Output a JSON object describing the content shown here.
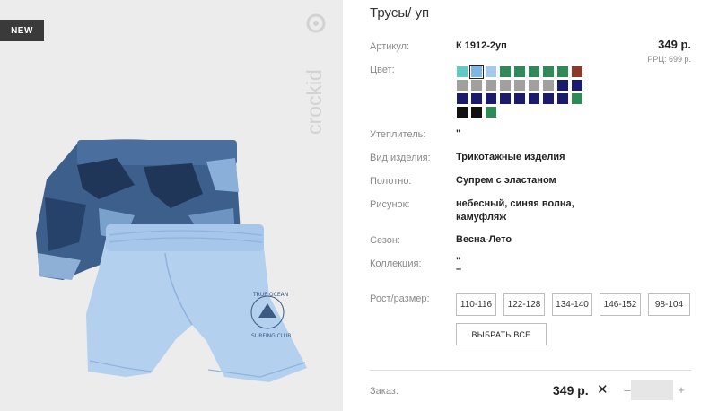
{
  "product": {
    "badge": "NEW",
    "brand": "crockid",
    "title": "Трусы/ уп"
  },
  "details": {
    "article_label": "Артикул:",
    "article_value": "К 1912-2уп",
    "price": "349 р.",
    "rrp": "РРЦ: 699 р.",
    "color_label": "Цвет:",
    "insulation_label": "Утеплитель:",
    "insulation_value": "\"",
    "type_label": "Вид изделия:",
    "type_value": "Трикотажные изделия",
    "fabric_label": "Полотно:",
    "fabric_value": "Супрем с эластаном",
    "pattern_label": "Рисунок:",
    "pattern_value_line1": "небесный, синяя волна,",
    "pattern_value_line2": "камуфляж",
    "season_label": "Сезон:",
    "season_value": "Весна-Лето",
    "collection_label": "Коллекция:",
    "collection_value_line1": "\"",
    "collection_value_line2": "–"
  },
  "swatches": [
    "#5ecbc4",
    "#7fb6e8",
    "#a5c9ee",
    "#2e8b57",
    "#2e8b57",
    "#2e8b57",
    "#2e8b57",
    "#2e8b57",
    "#8b3a2a",
    "#a0a0a0",
    "#a0a0a0",
    "#a0a0a0",
    "#a0a0a0",
    "#a0a0a0",
    "#a0a0a0",
    "#a0a0a0",
    "#1a1a6e",
    "#1a1a6e",
    "#1a1a6e",
    "#1a1a6e",
    "#1a1a6e",
    "#1a1a6e",
    "#1a1a6e",
    "#1a1a6e",
    "#1a1a6e",
    "#1a1a6e",
    "#2e8b57",
    "#111111",
    "#111111",
    "#2e8b57"
  ],
  "selected_swatch_index": 1,
  "sizes": {
    "label": "Рост/размер:",
    "options": [
      "110-116",
      "122-128",
      "134-140",
      "146-152",
      "98-104"
    ],
    "select_all": "ВЫБРАТЬ ВСЕ"
  },
  "order": {
    "label": "Заказ:",
    "price": "349 р.",
    "remove_glyph": "✕",
    "minus": "–",
    "plus": "+",
    "quantity": ""
  },
  "print_text": {
    "line1": "TRUE OCEAN",
    "line2": "SURFING CLUB"
  }
}
